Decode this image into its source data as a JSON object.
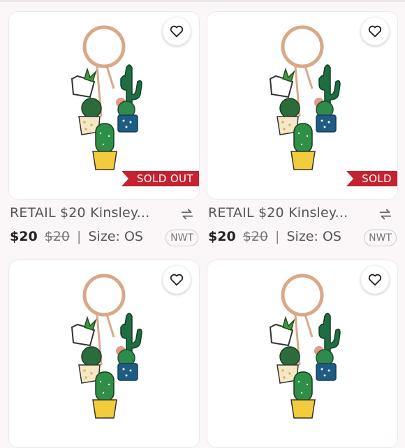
{
  "listings": [
    {
      "title": "RETAIL $20 Kinsley...",
      "price": "$20",
      "original_price": "$20",
      "size_label": "Size:",
      "size": "OS",
      "condition": "NWT",
      "status": "SOLD OUT"
    },
    {
      "title": "RETAIL $20 Kinsley...",
      "price": "$20",
      "original_price": "$20",
      "size_label": "Size:",
      "size": "OS",
      "condition": "NWT",
      "status": "SOLD"
    },
    {
      "title": "",
      "price": "",
      "original_price": "",
      "size_label": "",
      "size": "",
      "condition": "",
      "status": ""
    },
    {
      "title": "",
      "price": "",
      "original_price": "",
      "size_label": "",
      "size": "",
      "condition": "",
      "status": ""
    }
  ],
  "icons": {
    "like": "heart-icon",
    "share": "share-icon"
  },
  "colors": {
    "sold_badge": "#c4222f",
    "background": "#fbf7f8"
  }
}
